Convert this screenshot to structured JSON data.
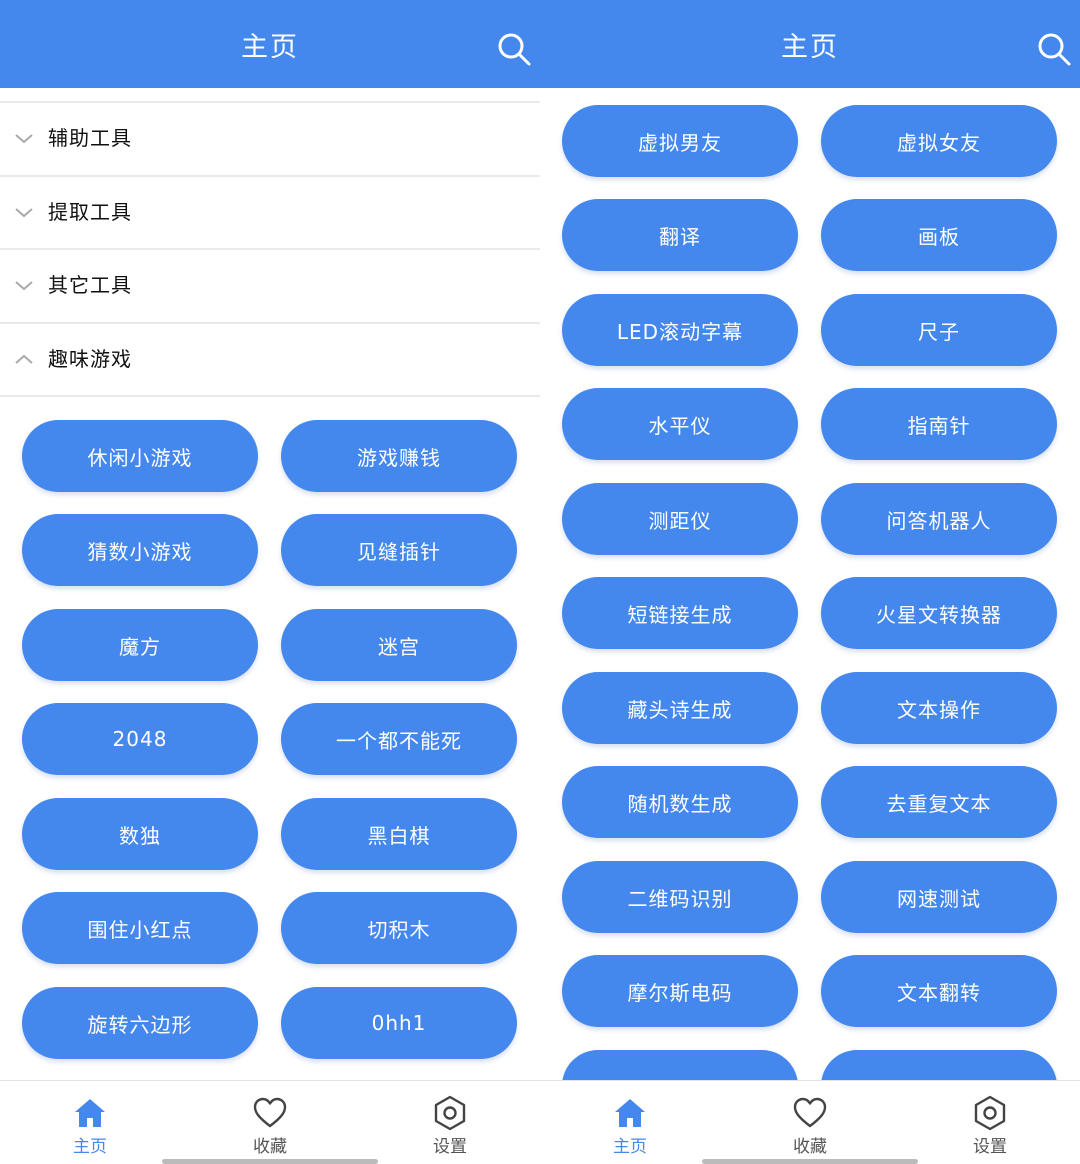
{
  "colors": {
    "primary": "#4488ee",
    "background": "#ffffff",
    "divider": "#e9e9ee",
    "text": "#111111"
  },
  "left": {
    "header": {
      "title": "主页",
      "search_icon": "search-icon"
    },
    "accordion": [
      {
        "label": "辅助工具",
        "state": "collapsed",
        "icon": "chevron-down-icon"
      },
      {
        "label": "提取工具",
        "state": "collapsed",
        "icon": "chevron-down-icon"
      },
      {
        "label": "其它工具",
        "state": "collapsed",
        "icon": "chevron-down-icon"
      },
      {
        "label": "趣味游戏",
        "state": "expanded",
        "icon": "chevron-up-icon"
      }
    ],
    "buttons": [
      "休闲小游戏",
      "游戏赚钱",
      "猜数小游戏",
      "见缝插针",
      "魔方",
      "迷宫",
      "2048",
      "一个都不能死",
      "数独",
      "黑白棋",
      "围住小红点",
      "切积木",
      "旋转六边形",
      "0hh1"
    ],
    "nav": [
      {
        "label": "主页",
        "icon": "home-icon",
        "active": true
      },
      {
        "label": "收藏",
        "icon": "heart-icon",
        "active": false
      },
      {
        "label": "设置",
        "icon": "settings-icon",
        "active": false
      }
    ]
  },
  "right": {
    "header": {
      "title": "主页",
      "search_icon": "search-icon"
    },
    "buttons": [
      "虚拟男友",
      "虚拟女友",
      "翻译",
      "画板",
      "LED滚动字幕",
      "尺子",
      "水平仪",
      "指南针",
      "测距仪",
      "问答机器人",
      "短链接生成",
      "火星文转换器",
      "藏头诗生成",
      "文本操作",
      "随机数生成",
      "去重复文本",
      "二维码识别",
      "网速测试",
      "摩尔斯电码",
      "文本翻转"
    ],
    "nav": [
      {
        "label": "主页",
        "icon": "home-icon",
        "active": true
      },
      {
        "label": "收藏",
        "icon": "heart-icon",
        "active": false
      },
      {
        "label": "设置",
        "icon": "settings-icon",
        "active": false
      }
    ]
  }
}
